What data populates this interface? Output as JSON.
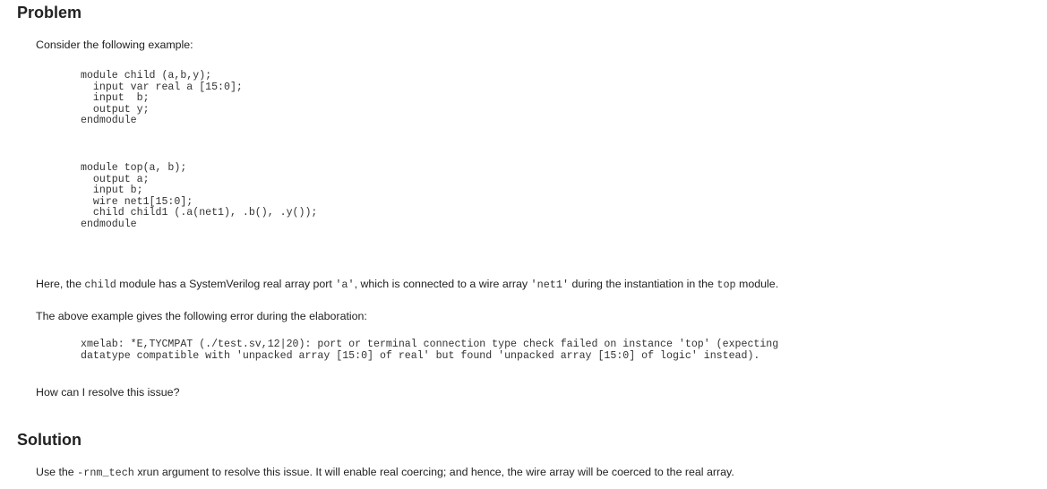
{
  "problem": {
    "heading": "Problem",
    "intro": "Consider the following example:",
    "code_child": "module child (a,b,y);\n  input var real a [15:0];\n  input  b;\n  output y;\nendmodule",
    "code_top": "module top(a, b);\n  output a;\n  input b;\n  wire net1[15:0];\n  child child1 (.a(net1), .b(), .y());\nendmodule",
    "explanation": {
      "t1": "Here, the ",
      "c1": "child",
      "t2": " module has a SystemVerilog real array port ",
      "c2": "'a'",
      "t3": ", which is connected to a wire array ",
      "c3": "'net1'",
      "t4": " during the instantiation in the ",
      "c4": "top",
      "t5": " module."
    },
    "error_intro": "The above example gives the following error during the elaboration:",
    "error_text": "xmelab: *E,TYCMPAT (./test.sv,12|20): port or terminal connection type check failed on instance 'top' (expecting\ndatatype compatible with 'unpacked array [15:0] of real' but found 'unpacked array [15:0] of logic' instead).",
    "question": "How can I resolve this issue?"
  },
  "solution": {
    "heading": "Solution",
    "t1": "Use the ",
    "c1": "-rnm_tech",
    "t2": " xrun argument to resolve this issue. It will enable real coercing; and hence, the wire array will be coerced to the real array."
  }
}
